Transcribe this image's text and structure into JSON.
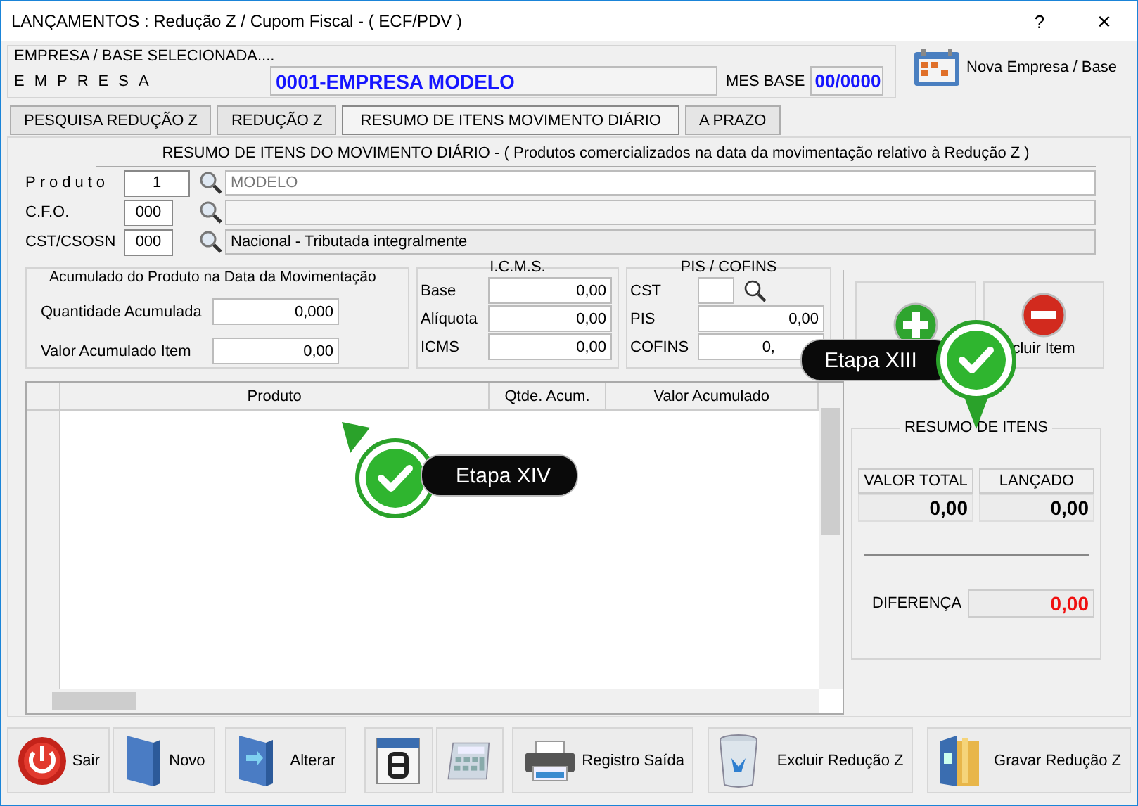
{
  "window": {
    "title": "LANÇAMENTOS : Redução Z / Cupom Fiscal - ( ECF/PDV )",
    "help": "?",
    "close": "✕"
  },
  "company": {
    "group_label": "EMPRESA  /  BASE  SELECIONADA....",
    "label": "EMPRESA",
    "value": "0001-EMPRESA MODELO",
    "month_label": "MES BASE",
    "month_value": "00/0000"
  },
  "new_company_button": "Nova Empresa / Base",
  "tabs": [
    {
      "label": "PESQUISA REDUÇÃO Z",
      "selected": false
    },
    {
      "label": "REDUÇÃO Z",
      "selected": false
    },
    {
      "label": "RESUMO DE ITENS MOVIMENTO DIÁRIO",
      "selected": true
    },
    {
      "label": "A PRAZO",
      "selected": false
    }
  ],
  "section_title": "RESUMO DE ITENS DO MOVIMENTO DIÁRIO - ( Produtos comercializados na data da movimentação relativo à Redução Z )",
  "product_fields": [
    {
      "label": "Produto",
      "spaced": true,
      "code": "1",
      "description": "MODELO"
    },
    {
      "label": "C.F.O.",
      "spaced": false,
      "code": "000"
    },
    {
      "label": "CST/CSOSN",
      "spaced": false,
      "code": "000",
      "description": "Nacional - Tributada integralmente"
    }
  ],
  "accumulated": {
    "title": "Acumulado do Produto na Data da Movimentação",
    "rows": [
      {
        "label": "Quantidade Acumulada",
        "value": "0,000"
      },
      {
        "label": "Valor Acumulado Item",
        "value": "0,00"
      }
    ]
  },
  "icms": {
    "title": "I.C.M.S.",
    "rows": [
      {
        "label": "Base",
        "value": "0,00"
      },
      {
        "label": "Alíquota",
        "value": "0,00"
      },
      {
        "label": "ICMS",
        "value": "0,00"
      }
    ]
  },
  "pis_cofins": {
    "title": "PIS / COFINS",
    "cst_label": "CST",
    "rows": [
      {
        "label": "PIS",
        "value": "0,00"
      },
      {
        "label": "COFINS",
        "value": "0,"
      }
    ]
  },
  "item_buttons": [
    {
      "kind": "add"
    },
    {
      "kind": "remove",
      "label": "cluir Item"
    }
  ],
  "grid": {
    "columns": [
      "Produto",
      "Qtde. Acum.",
      "Valor Acumulado"
    ]
  },
  "summary": {
    "title": "RESUMO DE ITENS",
    "columns": [
      {
        "label": "VALOR TOTAL",
        "value": "0,00"
      },
      {
        "label": "LANÇADO",
        "value": "0,00"
      }
    ],
    "difference_label": "DIFERENÇA",
    "difference_value": "0,00"
  },
  "callouts": [
    {
      "label": "Etapa XIII",
      "kind": "down"
    },
    {
      "label": "Etapa XIV",
      "kind": "up"
    }
  ],
  "toolbar": [
    {
      "kind": "exit",
      "label": "Sair"
    },
    {
      "kind": "new",
      "label": "Novo"
    },
    {
      "kind": "edit",
      "label": "Alterar"
    },
    {
      "kind": "calendar"
    },
    {
      "kind": "calculator"
    },
    {
      "kind": "print",
      "label": "Registro Saída"
    },
    {
      "kind": "delete",
      "label": "Excluir Redução Z"
    },
    {
      "kind": "save",
      "label": "Gravar Redução Z"
    }
  ]
}
